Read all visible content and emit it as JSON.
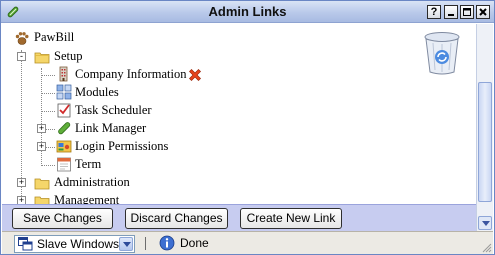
{
  "window": {
    "title": "Admin Links",
    "controls": {
      "help": "?",
      "minimize": "_",
      "maximize": "□",
      "close": "x"
    }
  },
  "tree": {
    "root": {
      "label": "PawBill",
      "icon": "paw-icon"
    },
    "setup": {
      "label": "Setup",
      "expander": "-",
      "children": [
        {
          "label": "Company Information",
          "icon": "building-icon",
          "has_delete": true
        },
        {
          "label": "Modules",
          "icon": "modules-icon"
        },
        {
          "label": "Task Scheduler",
          "icon": "checklist-icon"
        },
        {
          "label": "Link Manager",
          "icon": "link-icon",
          "expander": "+"
        },
        {
          "label": "Login Permissions",
          "icon": "permissions-icon",
          "expander": "+"
        },
        {
          "label": "Term",
          "icon": "calendar-icon"
        }
      ]
    },
    "administration": {
      "label": "Administration",
      "expander": "+"
    },
    "management": {
      "label": "Management",
      "expander": "+"
    }
  },
  "buttons": {
    "save": "Save Changes",
    "discard": "Discard Changes",
    "create": "Create New Link"
  },
  "status": {
    "window_mode": "Slave Windows",
    "separator": "|",
    "message": "Done"
  },
  "colors": {
    "titlebar": "#b9c9ea",
    "button_bar": "#c7ccf0",
    "status_bar": "#eceae4",
    "delete_icon": "#e8441c"
  }
}
